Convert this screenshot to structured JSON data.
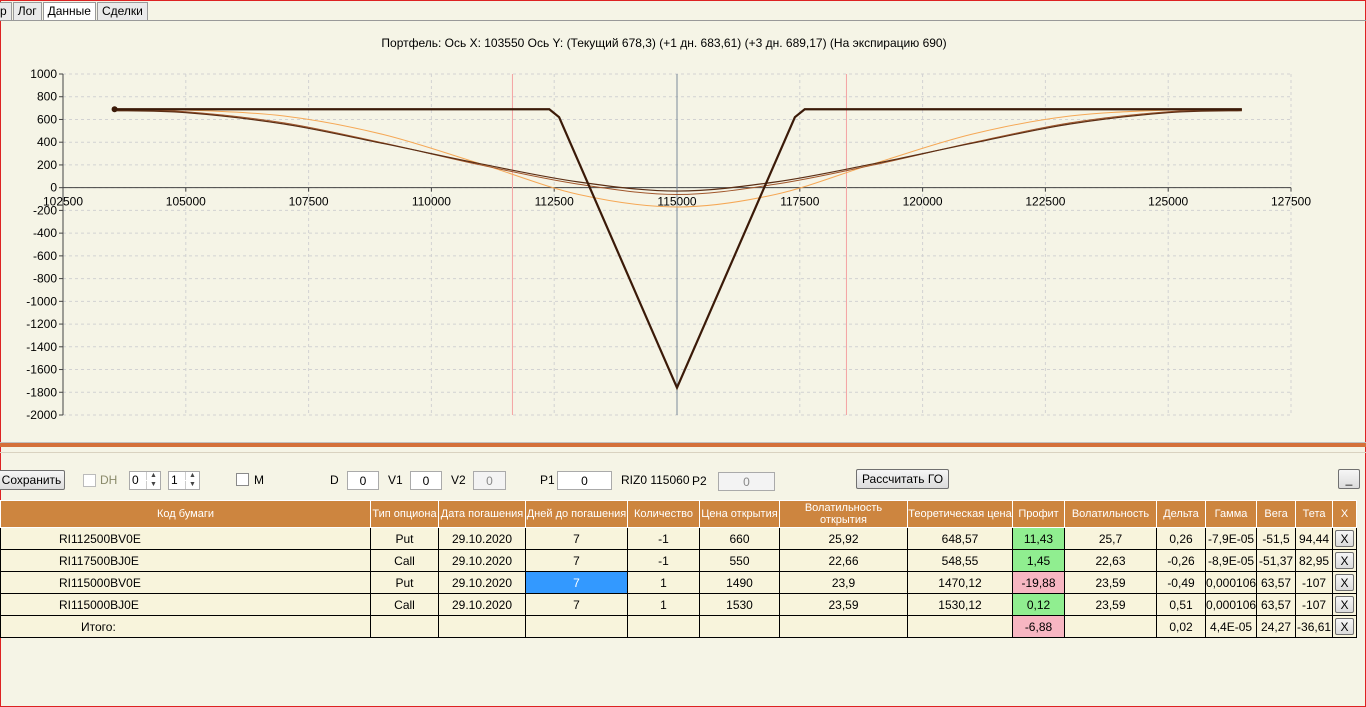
{
  "tabs": [
    "р",
    "Лог",
    "Данные",
    "Сделки"
  ],
  "chart_title": "Портфель: Ось X: 103550 Ось Y:  (Текущий 678,3)  (+1 дн. 683,61)  (+3 дн. 689,17)  (На экспирацию 690)",
  "chart_data": {
    "type": "line",
    "xlim": [
      102500,
      127500
    ],
    "ylim": [
      -2000,
      1000
    ],
    "x_ticks": [
      "102500",
      "105000",
      "107500",
      "110000",
      "112500",
      "115000",
      "117500",
      "120000",
      "122500",
      "125000",
      "127500"
    ],
    "y_ticks": [
      "1000",
      "800",
      "600",
      "400",
      "200",
      "0",
      "-200",
      "-400",
      "-600",
      "-800",
      "-1000",
      "-1200",
      "-1400",
      "-1600",
      "-1800",
      "-2000"
    ],
    "vertical_lines": [
      {
        "x": 111650,
        "color": "#f4a3a3"
      },
      {
        "x": 115000,
        "color": "#7a8a99"
      },
      {
        "x": 118450,
        "color": "#f4a3a3"
      }
    ],
    "series": [
      {
        "color": "#3b1a08",
        "width": 2.2,
        "points": [
          [
            103550,
            690
          ],
          [
            112400,
            690
          ],
          [
            112600,
            620
          ],
          [
            115000,
            -1760
          ],
          [
            117400,
            620
          ],
          [
            117600,
            690
          ],
          [
            126500,
            690
          ]
        ]
      },
      {
        "color": "#5b2e14",
        "width": 1.2,
        "points": [
          [
            103550,
            678
          ],
          [
            105000,
            660
          ],
          [
            107000,
            560
          ],
          [
            109000,
            390
          ],
          [
            111000,
            210
          ],
          [
            113000,
            50
          ],
          [
            115000,
            -30
          ],
          [
            117000,
            50
          ],
          [
            119000,
            210
          ],
          [
            121000,
            390
          ],
          [
            123000,
            560
          ],
          [
            125000,
            660
          ],
          [
            126500,
            678
          ]
        ]
      },
      {
        "color": "#a0552a",
        "width": 1.0,
        "points": [
          [
            103550,
            684
          ],
          [
            105000,
            668
          ],
          [
            107000,
            570
          ],
          [
            109000,
            395
          ],
          [
            111000,
            200
          ],
          [
            113000,
            30
          ],
          [
            115000,
            -60
          ],
          [
            117000,
            30
          ],
          [
            119000,
            200
          ],
          [
            121000,
            395
          ],
          [
            123000,
            570
          ],
          [
            125000,
            668
          ],
          [
            126500,
            684
          ]
        ]
      },
      {
        "color": "#f5a856",
        "width": 1.0,
        "points": [
          [
            103550,
            689
          ],
          [
            105000,
            683
          ],
          [
            107000,
            630
          ],
          [
            109000,
            470
          ],
          [
            111000,
            210
          ],
          [
            113000,
            -60
          ],
          [
            115000,
            -170
          ],
          [
            117000,
            -60
          ],
          [
            119000,
            210
          ],
          [
            121000,
            470
          ],
          [
            123000,
            630
          ],
          [
            125000,
            683
          ],
          [
            126500,
            689
          ]
        ]
      }
    ]
  },
  "toolbar": {
    "save_label": "Сохранить",
    "dh_label": "DH",
    "spin1": "0",
    "spin2": "1",
    "m_label": "M",
    "d_label": "D",
    "d_value": "0",
    "v1_label": "V1",
    "v1_value": "0",
    "v2_label": "V2",
    "v2_value": "0",
    "p1_label": "P1",
    "p1_value": "0",
    "instrument": "RIZ0 115060",
    "p2_label": "P2",
    "p2_value": "0",
    "calc_label": "Рассчитать ГО",
    "min_label": "_"
  },
  "table": {
    "headers": [
      "Код бумаги",
      "Тип опциона",
      "Дата погашения",
      "Дней до погашения",
      "Количество",
      "Цена открытия",
      "Волатильность открытия",
      "Теоретическая цена",
      "Профит",
      "Волатильность",
      "Дельта",
      "Гамма",
      "Вега",
      "Тета",
      "X"
    ],
    "rows": [
      {
        "code": "RI112500BV0E",
        "type": "Put",
        "date": "29.10.2020",
        "days": "7",
        "qty": "-1",
        "price": "660",
        "open_vol": "25,92",
        "theor": "648,57",
        "profit": "11,43",
        "vol": "25,7",
        "delta": "0,26",
        "gamma": "-7,9E-05",
        "vega": "-51,5",
        "theta": "94,44",
        "x": "X"
      },
      {
        "code": "RI117500BJ0E",
        "type": "Call",
        "date": "29.10.2020",
        "days": "7",
        "qty": "-1",
        "price": "550",
        "open_vol": "22,66",
        "theor": "548,55",
        "profit": "1,45",
        "vol": "22,63",
        "delta": "-0,26",
        "gamma": "-8,9E-05",
        "vega": "-51,37",
        "theta": "82,95",
        "x": "X"
      },
      {
        "code": "RI115000BV0E",
        "type": "Put",
        "date": "29.10.2020",
        "days": "7",
        "qty": "1",
        "price": "1490",
        "open_vol": "23,9",
        "theor": "1470,12",
        "profit": "-19,88",
        "vol": "23,59",
        "delta": "-0,49",
        "gamma": "0,000106",
        "vega": "63,57",
        "theta": "-107",
        "x": "X"
      },
      {
        "code": "RI115000BJ0E",
        "type": "Call",
        "date": "29.10.2020",
        "days": "7",
        "qty": "1",
        "price": "1530",
        "open_vol": "23,59",
        "theor": "1530,12",
        "profit": "0,12",
        "vol": "23,59",
        "delta": "0,51",
        "gamma": "0,000106",
        "vega": "63,57",
        "theta": "-107",
        "x": "X"
      }
    ],
    "total": {
      "label": "Итого:",
      "profit": "-6,88",
      "delta": "0,02",
      "gamma": "4,4E-05",
      "vega": "24,27",
      "theta": "-36,61",
      "x": "X"
    }
  }
}
